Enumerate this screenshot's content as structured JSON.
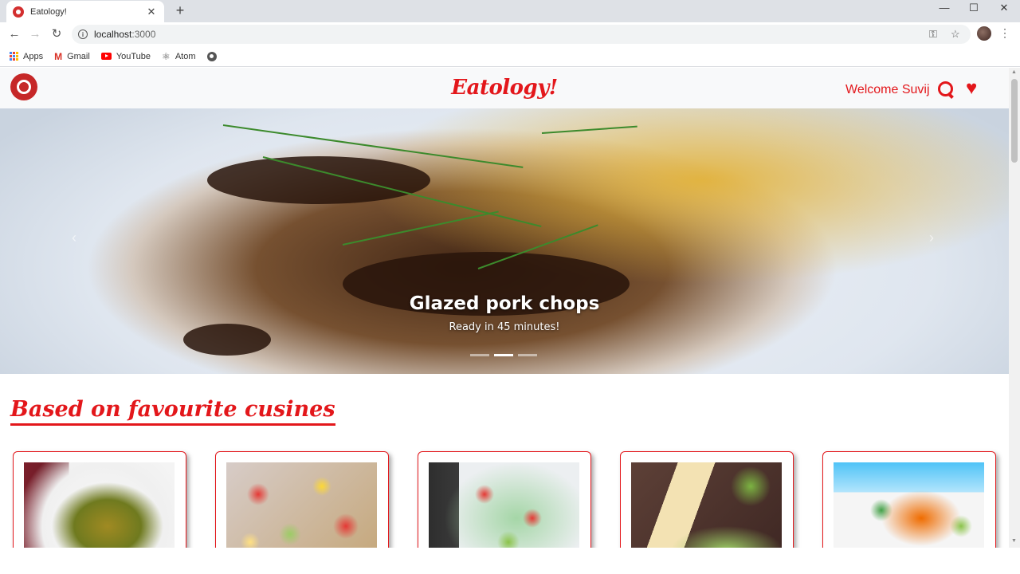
{
  "browser": {
    "tab_title": "Eatology!",
    "tab_close": "✕",
    "new_tab": "+",
    "url_host": "localhost",
    "url_port": ":3000",
    "window_controls": {
      "minimize": "—",
      "maximize": "☐",
      "close": "✕"
    },
    "bookmarks": [
      {
        "label": "Apps",
        "icon": "apps-grid-icon"
      },
      {
        "label": "Gmail",
        "icon": "gmail-icon"
      },
      {
        "label": "YouTube",
        "icon": "youtube-icon"
      },
      {
        "label": "Atom",
        "icon": "atom-icon"
      }
    ]
  },
  "site": {
    "brand": "Eatology!",
    "welcome": "Welcome Suvij",
    "accent": "#e3171b"
  },
  "carousel": {
    "title": "Glazed pork chops",
    "subtitle": "Ready in 45 minutes!",
    "slides": 3,
    "active_index": 1
  },
  "section": {
    "title": "Based on favourite cusines"
  },
  "cards": [
    {
      "name": "card-1"
    },
    {
      "name": "card-2"
    },
    {
      "name": "card-3"
    },
    {
      "name": "card-4"
    },
    {
      "name": "card-5"
    }
  ]
}
